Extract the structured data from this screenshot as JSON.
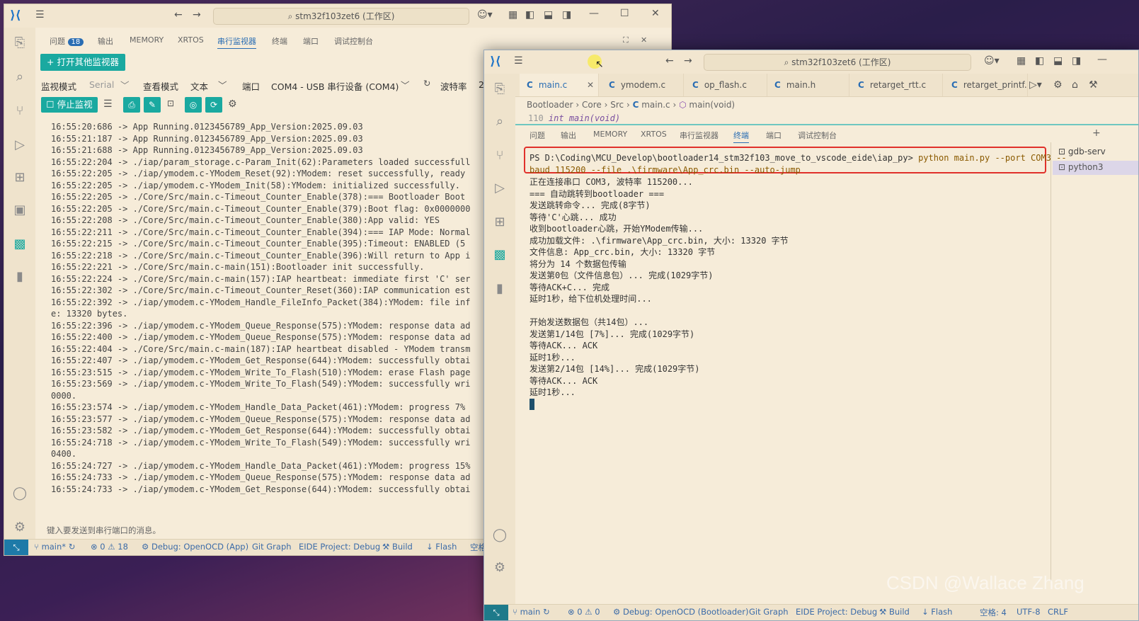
{
  "win1": {
    "title": "stm32f103zet6 (工作区)",
    "panel_tabs": [
      {
        "label": "问题",
        "badge": "18"
      },
      {
        "label": "输出"
      },
      {
        "label": "MEMORY"
      },
      {
        "label": "XRTOS"
      },
      {
        "label": "串行监视器",
        "active": true
      },
      {
        "label": "终端"
      },
      {
        "label": "端口"
      },
      {
        "label": "调试控制台"
      }
    ],
    "open_monitor_button": "+ 打开其他监视器",
    "toolbar": {
      "mode_label": "监视模式",
      "mode_value": "Serial",
      "view_label": "查看模式",
      "view_value": "文本",
      "port_label": "端口",
      "port_value": "COM4 - USB 串行设备 (COM4)",
      "baud_label": "波特率",
      "baud_value": "2"
    },
    "stop_button": "☐ 停止监视",
    "log_lines": [
      "16:55:20:686 -> App Running.0123456789_App_Version:2025.09.03",
      "16:55:21:187 -> App Running.0123456789_App_Version:2025.09.03",
      "16:55:21:688 -> App Running.0123456789_App_Version:2025.09.03",
      "16:55:22:204 -> ./iap/param_storage.c-Param_Init(62):Parameters loaded successfull",
      "16:55:22:205 -> ./iap/ymodem.c-YModem_Reset(92):YModem: reset successfully, ready",
      "16:55:22:205 -> ./iap/ymodem.c-YModem_Init(58):YModem: initialized successfully.",
      "16:55:22:205 -> ./Core/Src/main.c-Timeout_Counter_Enable(378):=== Bootloader Boot",
      "16:55:22:205 -> ./Core/Src/main.c-Timeout_Counter_Enable(379):Boot flag: 0x0000000",
      "16:55:22:208 -> ./Core/Src/main.c-Timeout_Counter_Enable(380):App valid: YES",
      "16:55:22:211 -> ./Core/Src/main.c-Timeout_Counter_Enable(394):=== IAP Mode: Normal",
      "16:55:22:215 -> ./Core/Src/main.c-Timeout_Counter_Enable(395):Timeout: ENABLED (5",
      "16:55:22:218 -> ./Core/Src/main.c-Timeout_Counter_Enable(396):Will return to App i",
      "16:55:22:221 -> ./Core/Src/main.c-main(151):Bootloader init successfully.",
      "16:55:22:224 -> ./Core/Src/main.c-main(157):IAP heartbeat: immediate first 'C' ser",
      "16:55:22:302 -> ./Core/Src/main.c-Timeout_Counter_Reset(360):IAP communication est",
      "16:55:22:392 -> ./iap/ymodem.c-YModem_Handle_FileInfo_Packet(384):YModem: file inf",
      "e: 13320 bytes.",
      "16:55:22:396 -> ./iap/ymodem.c-YModem_Queue_Response(575):YModem: response data ad",
      "16:55:22:400 -> ./iap/ymodem.c-YModem_Queue_Response(575):YModem: response data ad",
      "16:55:22:404 -> ./Core/Src/main.c-main(187):IAP heartbeat disabled - YModem transm",
      "16:55:22:407 -> ./iap/ymodem.c-YModem_Get_Response(644):YModem: successfully obtai",
      "16:55:23:515 -> ./iap/ymodem.c-YModem_Write_To_Flash(510):YModem: erase Flash page",
      "16:55:23:569 -> ./iap/ymodem.c-YModem_Write_To_Flash(549):YModem: successfully wri",
      "0000.",
      "16:55:23:574 -> ./iap/ymodem.c-YModem_Handle_Data_Packet(461):YModem: progress 7%",
      "16:55:23:577 -> ./iap/ymodem.c-YModem_Queue_Response(575):YModem: response data ad",
      "16:55:23:582 -> ./iap/ymodem.c-YModem_Get_Response(644):YModem: successfully obtai",
      "16:55:24:718 -> ./iap/ymodem.c-YModem_Write_To_Flash(549):YModem: successfully wri",
      "0400.",
      "16:55:24:727 -> ./iap/ymodem.c-YModem_Handle_Data_Packet(461):YModem: progress 15%",
      "16:55:24:733 -> ./iap/ymodem.c-YModem_Queue_Response(575):YModem: response data ad",
      "16:55:24:733 -> ./iap/ymodem.c-YModem_Get_Response(644):YModem: successfully obtai"
    ],
    "input_placeholder": "键入要发送到串行端口的消息。",
    "status": {
      "branch": "main*",
      "errors": "0",
      "warnings": "18",
      "debug": "Debug: OpenOCD (App)",
      "gitgraph": "Git Graph",
      "eide": "EIDE Project: Debug",
      "build": "Build",
      "flash": "Flash",
      "more": "空格"
    }
  },
  "win2": {
    "title": "stm32f103zet6 (工作区)",
    "editor_tabs": [
      "main.c",
      "ymodem.c",
      "op_flash.c",
      "main.h",
      "retarget_rtt.c",
      "retarget_printf."
    ],
    "breadcrumb": [
      "Bootloader",
      "Core",
      "Src",
      "main.c",
      "main(void)"
    ],
    "code_line_no": "110",
    "code_line": "int main(void)",
    "panel_tabs": [
      "问题",
      "输出",
      "MEMORY",
      "XRTOS",
      "串行监视器",
      "终端",
      "端口",
      "调试控制台"
    ],
    "command_prompt": "PS D:\\Coding\\MCU_Develop\\bootloader14_stm32f103_move_to_vscode_eide\\iap_py> ",
    "command_text": "python main.py --port COM3 --",
    "command_cont": "baud 115200 --file .\\firmware\\App_crc.bin --auto-jump",
    "terminal_lines": [
      "正在连接串口 COM3, 波特率 115200...",
      "=== 自动跳转到bootloader ===",
      "发送跳转命令... 完成(8字节)",
      "等待'C'心跳... 成功",
      "收到bootloader心跳，开始YModem传输...",
      "成功加载文件: .\\firmware\\App_crc.bin, 大小: 13320 字节",
      "文件信息: App_crc.bin, 大小: 13320 字节",
      "将分为 14 个数据包传输",
      "发送第0包（文件信息包）... 完成(1029字节)",
      "等待ACK+C... 完成",
      "延时1秒，给下位机处理时间...",
      "",
      "开始发送数据包（共14包）...",
      "发送第1/14包 [7%]... 完成(1029字节)",
      "等待ACK... ACK",
      "延时1秒...",
      "发送第2/14包 [14%]... 完成(1029字节)",
      "等待ACK... ACK",
      "延时1秒..."
    ],
    "terminal_list": [
      "gdb-serv",
      "python3"
    ],
    "status": {
      "branch": "main",
      "errors": "0",
      "warnings": "0",
      "debug": "Debug: OpenOCD (Bootloader)",
      "gitgraph": "Git Graph",
      "eide": "EIDE Project: Debug",
      "build": "Build",
      "flash": "Flash",
      "spaces": "空格: 4",
      "encoding": "UTF-8",
      "eol": "CRLF"
    }
  },
  "watermark": "CSDN @Wallace Zhang",
  "colors": {
    "accent": "#2a6db3",
    "teal": "#1aa9a0",
    "highlight_box": "#e0302a",
    "command": "#8a5a00"
  }
}
